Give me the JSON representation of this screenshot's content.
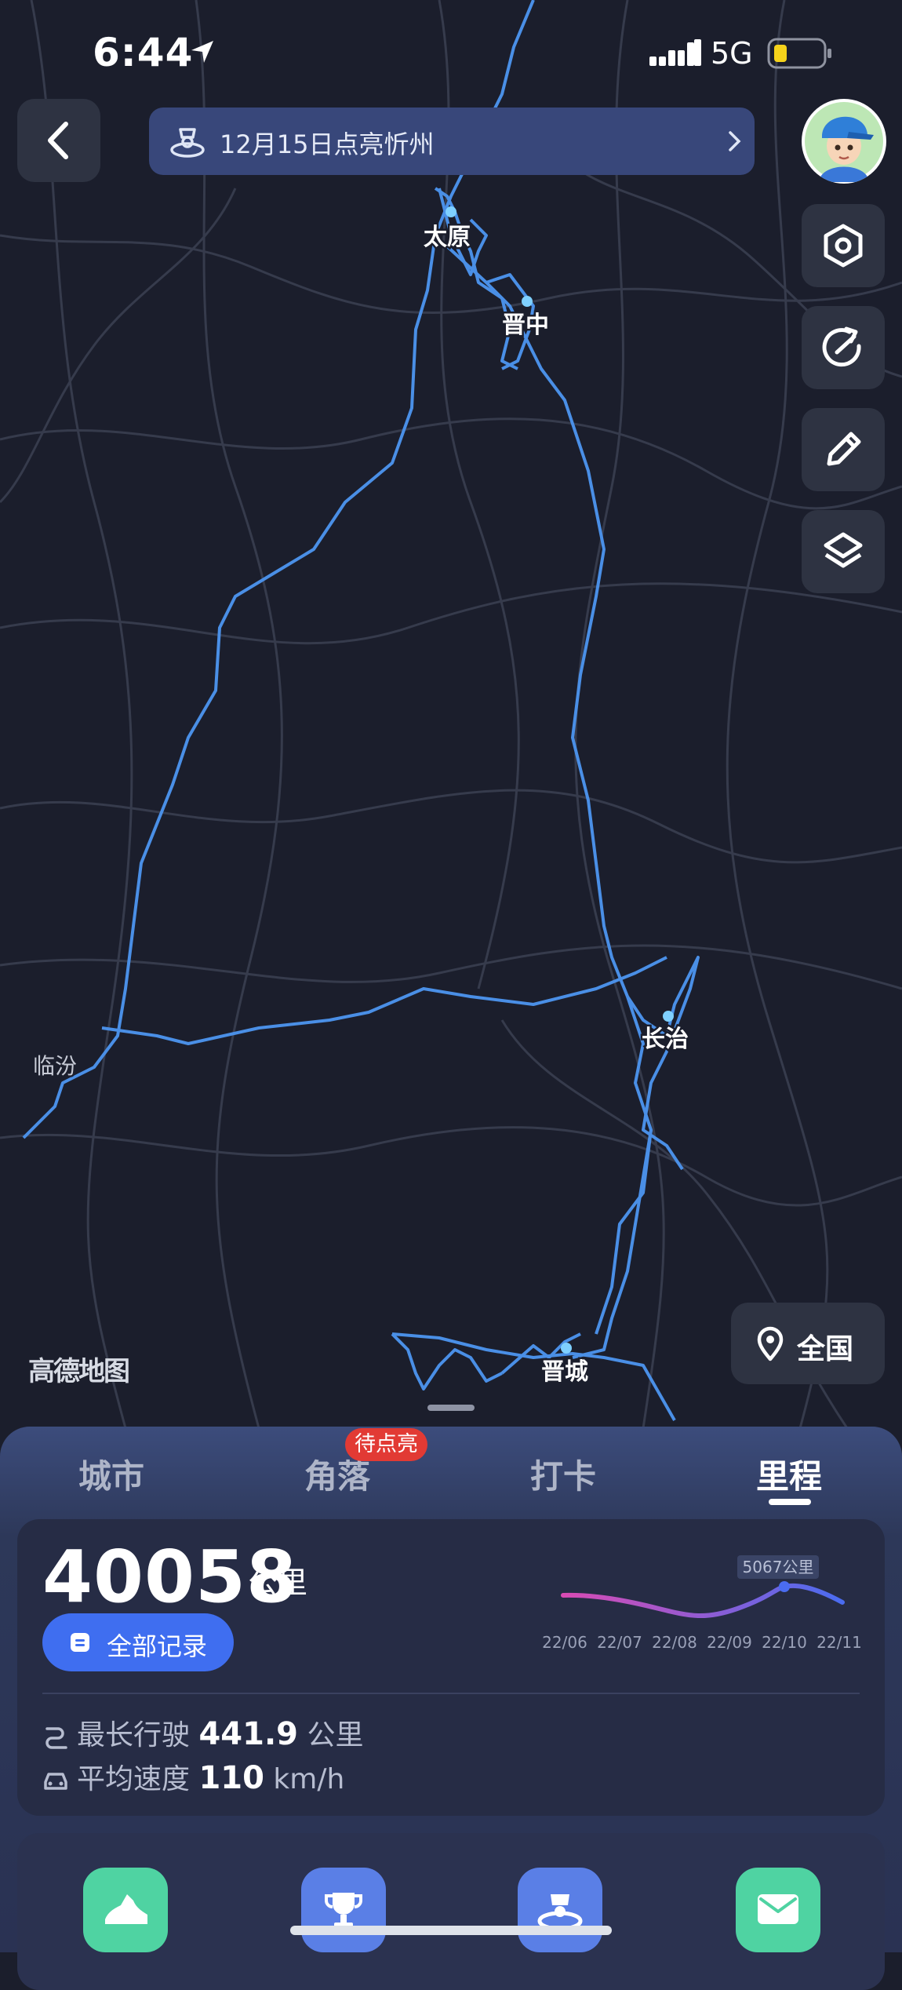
{
  "status_bar": {
    "time": "6:44",
    "network": "5G"
  },
  "banner": {
    "text": "12月15日点亮忻州"
  },
  "map": {
    "cities": [
      {
        "name": "太原"
      },
      {
        "name": "晋中"
      },
      {
        "name": "长治"
      },
      {
        "name": "临汾"
      },
      {
        "name": "晋城"
      }
    ],
    "logo": "高德地图",
    "quanguo_label": "全国"
  },
  "tabs": [
    {
      "label": "城市"
    },
    {
      "label": "角落",
      "badge": "待点亮"
    },
    {
      "label": "打卡"
    },
    {
      "label": "里程",
      "active": true
    }
  ],
  "mileage": {
    "value": "40058",
    "unit": "公里",
    "all_records_label": "全部记录",
    "trend": {
      "peak_label": "5067公里",
      "x_labels": [
        "22/06",
        "22/07",
        "22/08",
        "22/09",
        "22/10",
        "22/11"
      ]
    },
    "longest_drive_label": "最长行驶",
    "longest_drive_value": "441.9",
    "longest_drive_unit": "公里",
    "avg_speed_label": "平均速度",
    "avg_speed_value": "110",
    "avg_speed_unit": "km/h"
  },
  "colors": {
    "route": "#4a8fe6",
    "accent_blue": "#3f6ef0",
    "badge_red": "#e23a34",
    "trend_start": "#d94bb4",
    "trend_end": "#4a6cf0"
  }
}
